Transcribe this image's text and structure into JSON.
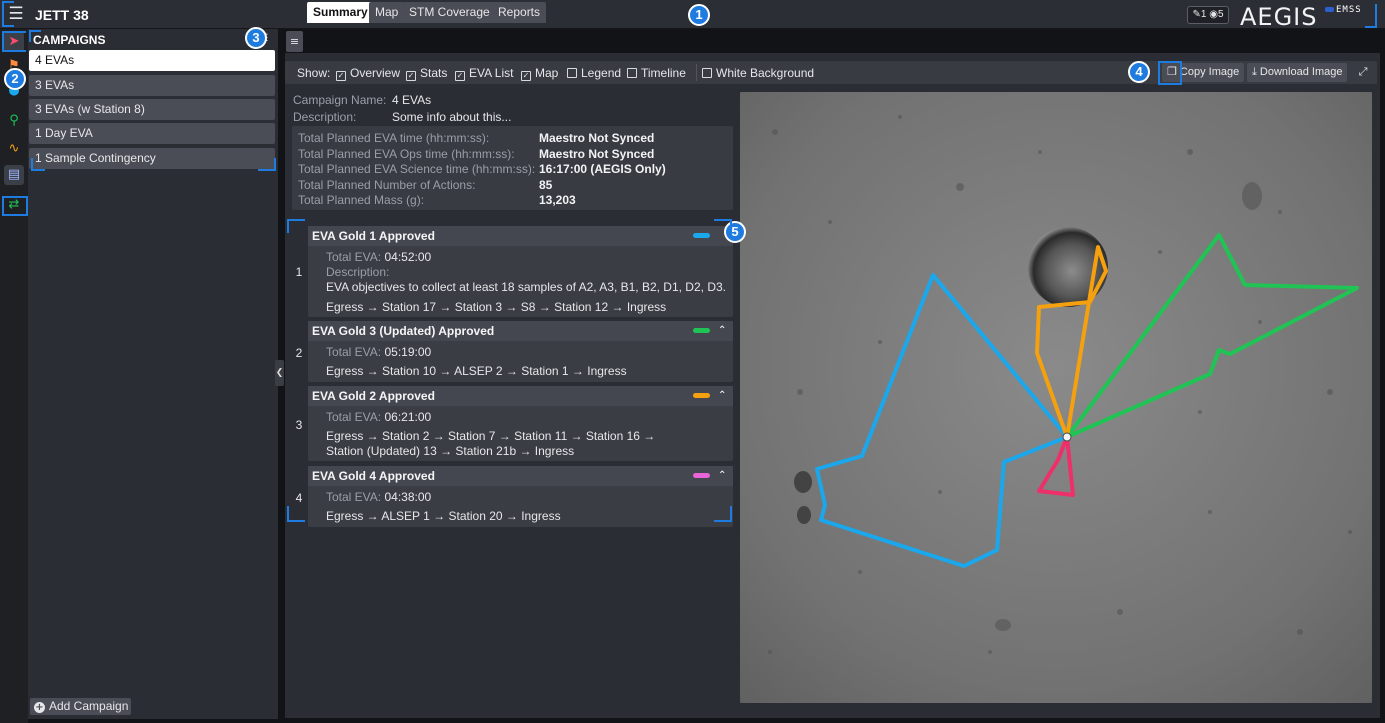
{
  "app": {
    "title": "JETT 38",
    "brand": "AEGIS",
    "partner": "EMSS",
    "edit_count": "1",
    "view_count": "5"
  },
  "rail": {
    "icons": [
      "rocket-icon",
      "flag-icon",
      "location-pin-icon",
      "route-icon",
      "table-icon",
      "run-arrows-icon"
    ]
  },
  "sidebar": {
    "heading": "CAMPAIGNS",
    "campaigns": [
      {
        "label": "4 EVAs",
        "selected": true
      },
      {
        "label": "3 EVAs",
        "selected": false
      },
      {
        "label": "3 EVAs (w Station 8)",
        "selected": false
      },
      {
        "label": "1 Day EVA",
        "selected": false
      },
      {
        "label": "1 Sample Contingency",
        "selected": false
      }
    ],
    "add_label": "Add Campaign"
  },
  "tabs": [
    "Summary",
    "Map",
    "STM Coverage",
    "Reports"
  ],
  "show": {
    "label": "Show:",
    "options": [
      {
        "label": "Overview",
        "checked": true
      },
      {
        "label": "Stats",
        "checked": true
      },
      {
        "label": "EVA List",
        "checked": true
      },
      {
        "label": "Map",
        "checked": true
      },
      {
        "label": "Legend",
        "checked": false
      },
      {
        "label": "Timeline",
        "checked": false
      },
      {
        "label": "White Background",
        "checked": false
      }
    ],
    "copy_label": "Copy Image",
    "download_label": "Download Image"
  },
  "campaign": {
    "name_label": "Campaign Name:",
    "name": "4 EVAs",
    "desc_label": "Description:",
    "desc": "Some info about this..."
  },
  "stats": [
    {
      "label": "Total Planned EVA time (hh:mm:ss):",
      "value": "Maestro Not Synced"
    },
    {
      "label": "Total Planned EVA Ops time (hh:mm:ss):",
      "value": "Maestro Not Synced"
    },
    {
      "label": "Total Planned EVA Science time (hh:mm:ss):",
      "value": "16:17:00 (AEGIS Only)"
    },
    {
      "label": "Total Planned Number of Actions:",
      "value": "85"
    },
    {
      "label": "Total Planned Mass (g):",
      "value": "13,203"
    }
  ],
  "evas": [
    {
      "num": "1",
      "title": "EVA Gold 1 Approved",
      "color": "#1aa7ec",
      "total_label": "Total EVA:",
      "total": "04:52:00",
      "desc_label": "Description:",
      "desc": "EVA objectives to collect at least 18 samples of A2, A3, B1, B2, D1, D2, D3.",
      "route": [
        "Egress → Station 17 → Station 3 → S8 → Station 12 → Ingress"
      ]
    },
    {
      "num": "2",
      "title": "EVA Gold 3 (Updated) Approved",
      "color": "#20c454",
      "total_label": "Total EVA:",
      "total": "05:19:00",
      "route": [
        "Egress → Station 10 → ALSEP 2 → Station 1 → Ingress"
      ]
    },
    {
      "num": "3",
      "title": "EVA Gold 2 Approved",
      "color": "#f5a00f",
      "total_label": "Total EVA:",
      "total": "06:21:00",
      "route": [
        "Egress → Station 2 → Station 7 → Station 11 → Station 16 →",
        "Station (Updated) 13 → Station 21b → Ingress"
      ]
    },
    {
      "num": "4",
      "title": "EVA Gold 4 Approved",
      "color": "#e864d8",
      "total_label": "Total EVA:",
      "total": "04:38:00",
      "route": [
        "Egress → ALSEP 1 → Station 20 → Ingress"
      ]
    }
  ],
  "callouts": [
    "1",
    "2",
    "3",
    "4",
    "5"
  ]
}
